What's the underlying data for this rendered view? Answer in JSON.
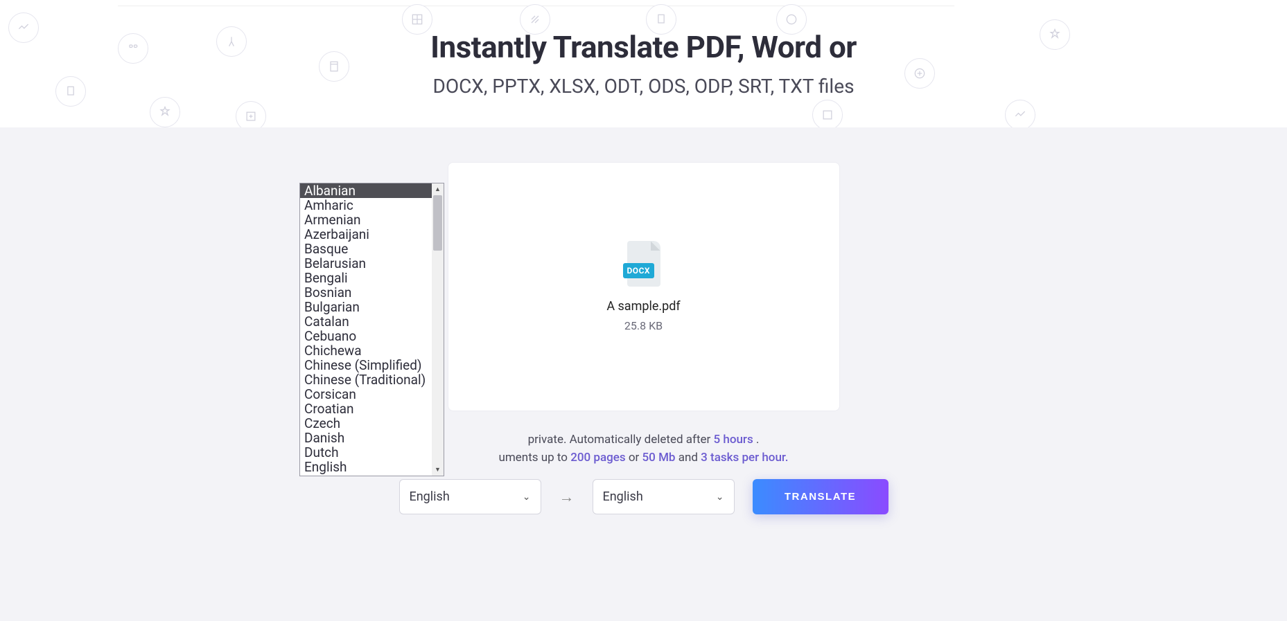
{
  "headline": {
    "title": "Instantly Translate PDF, Word or",
    "subtitle": "DOCX, PPTX, XLSX, ODT, ODS, ODP, SRT, TXT files"
  },
  "file": {
    "badge": "DOCX",
    "name": "A sample.pdf",
    "size": "25.8 KB"
  },
  "dropdown": {
    "options": [
      "Albanian",
      "Amharic",
      "Armenian",
      "Azerbaijani",
      "Basque",
      "Belarusian",
      "Bengali",
      "Bosnian",
      "Bulgarian",
      "Catalan",
      "Cebuano",
      "Chichewa",
      "Chinese (Simplified)",
      "Chinese (Traditional)",
      "Corsican",
      "Croatian",
      "Czech",
      "Danish",
      "Dutch",
      "English"
    ],
    "selected_index": 0
  },
  "info": {
    "line1_prefix": "private. Automatically deleted after ",
    "line1_hl": "5 hours",
    "line1_suffix": " .",
    "line2_prefix": "uments up to ",
    "line2_hl1": "200 pages",
    "line2_mid1": " or ",
    "line2_hl2": "50 Mb",
    "line2_mid2": " and ",
    "line2_hl3": "3 tasks per hour.",
    "line2_suffix": ""
  },
  "controls": {
    "from_lang": "English",
    "to_lang": "English",
    "translate_label": "TRANSLATE"
  }
}
